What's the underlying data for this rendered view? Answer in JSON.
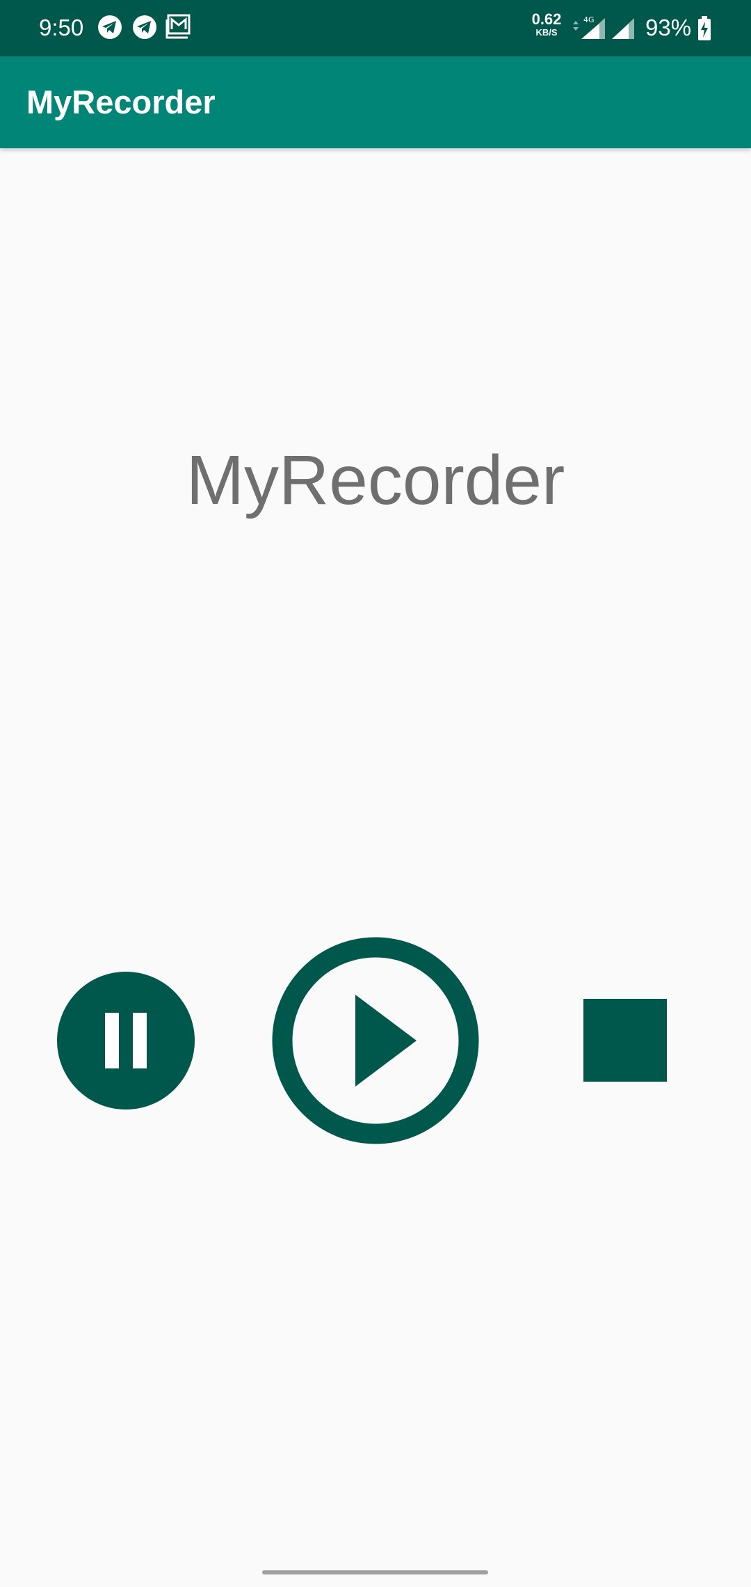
{
  "status_bar": {
    "time": "9:50",
    "notification_icons": [
      "telegram-icon",
      "telegram-icon",
      "gmail-icon"
    ],
    "network_speed_value": "0.62",
    "network_speed_unit": "KB/S",
    "network_type": "4G",
    "battery_percent": "93%"
  },
  "app_bar": {
    "title": "MyRecorder"
  },
  "main": {
    "label": "MyRecorder"
  },
  "controls": {
    "pause_icon": "pause-icon",
    "play_icon": "play-icon",
    "stop_icon": "stop-icon"
  },
  "colors": {
    "status_bar": "#00574b",
    "app_bar": "#008577",
    "accent_dark": "#00574b",
    "label_text": "#6f6f6f",
    "background": "#fafafa"
  }
}
